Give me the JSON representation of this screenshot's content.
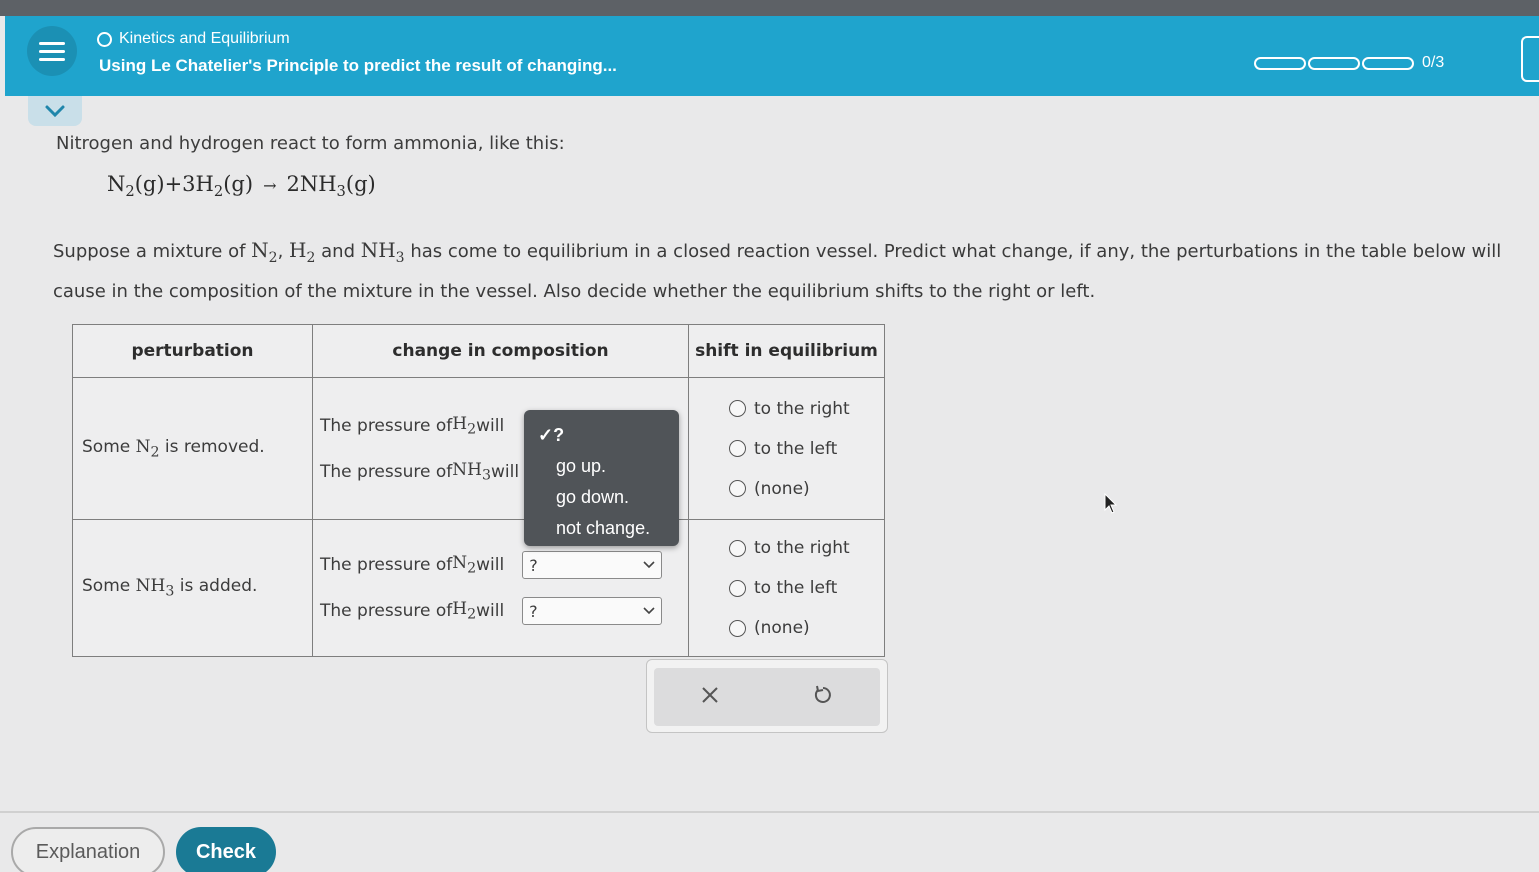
{
  "header": {
    "topic": "Kinetics and Equilibrium",
    "title": "Using Le Chatelier's Principle to predict the result of changing...",
    "progress_text": "0/3",
    "progress_value": 0,
    "progress_total": 3
  },
  "problem": {
    "intro": "Nitrogen and hydrogen react to form ammonia, like this:",
    "equation": {
      "n2": "N",
      "n2_sub": "2",
      "n2_state": "(g)",
      "plus": "+3H",
      "h2_sub": "2",
      "h2_state": "(g)",
      "arrow": "→",
      "nh3": "2NH",
      "nh3_sub": "3",
      "nh3_state": "(g)"
    },
    "q_part1": "Suppose a mixture of ",
    "q_n": "N",
    "q_n_sub": "2",
    "q_comma1": ", ",
    "q_h": "H",
    "q_h_sub": "2",
    "q_and": " and ",
    "q_nh": "NH",
    "q_nh_sub": "3",
    "q_part2": " has come to equilibrium in a closed reaction vessel. Predict what change, if any, the perturbations in the table below will cause in the composition of the mixture in the vessel. Also decide whether the equilibrium shifts to the right or left."
  },
  "table": {
    "headers": [
      "perturbation",
      "change in composition",
      "shift in equilibrium"
    ],
    "rows": [
      {
        "perturbation_pre": "Some ",
        "perturbation_chem": "N",
        "perturbation_sub": "2",
        "perturbation_post": " is removed.",
        "lines": [
          {
            "pre": "The pressure of ",
            "chem": "H",
            "sub": "2",
            "post": " will",
            "value": "?"
          },
          {
            "pre": "The pressure of ",
            "chem": "NH",
            "sub": "3",
            "post": " will",
            "value": "?"
          }
        ],
        "options": [
          "to the right",
          "to the left",
          "(none)"
        ]
      },
      {
        "perturbation_pre": "Some ",
        "perturbation_chem": "NH",
        "perturbation_sub": "3",
        "perturbation_post": " is added.",
        "lines": [
          {
            "pre": "The pressure of ",
            "chem": "N",
            "sub": "2",
            "post": " will",
            "value": "?"
          },
          {
            "pre": "The pressure of ",
            "chem": "H",
            "sub": "2",
            "post": " will",
            "value": "?"
          }
        ],
        "options": [
          "to the right",
          "to the left",
          "(none)"
        ]
      }
    ]
  },
  "dropdown": {
    "selected": "✓?",
    "options": [
      "go up.",
      "go down.",
      "not change."
    ]
  },
  "actions": {
    "clear": "×",
    "undo": "↺"
  },
  "footer": {
    "explanation": "Explanation",
    "check": "Check"
  },
  "colors": {
    "header": "#1fa4cd",
    "check_button": "#1a7a95",
    "dropdown_bg": "#505458"
  }
}
